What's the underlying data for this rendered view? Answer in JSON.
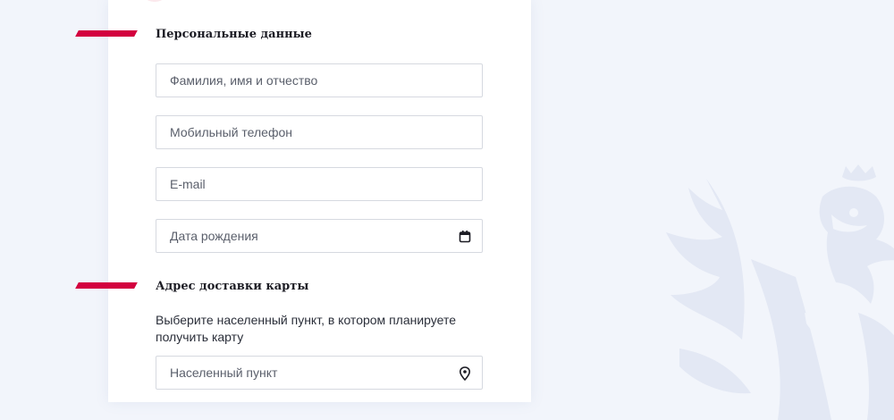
{
  "sections": {
    "personal": {
      "title": "Персональные данные"
    },
    "delivery": {
      "title": "Адрес доставки карты",
      "hint": "Выберите населенный пункт, в котором планируете получить карту"
    }
  },
  "fields": {
    "full_name": {
      "placeholder": "Фамилия, имя и отчество",
      "value": ""
    },
    "phone": {
      "placeholder": "Мобильный телефон",
      "value": ""
    },
    "email": {
      "placeholder": "E-mail",
      "value": ""
    },
    "birth_date": {
      "placeholder": "Дата рождения",
      "value": "",
      "icon": "calendar-icon"
    },
    "locality": {
      "placeholder": "Населенный пункт",
      "value": "",
      "icon": "location-pin-icon"
    }
  },
  "colors": {
    "accent": "#d3003f",
    "background": "#f2f5fb",
    "card": "#ffffff",
    "border": "#d6d9e0"
  }
}
